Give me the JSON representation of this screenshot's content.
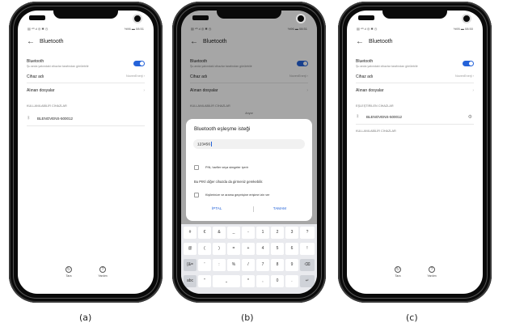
{
  "screens": {
    "a": {
      "status_left": "▤ ⁴ᴳ.ıl ◎ ✱ ◷",
      "status_right": "%96 ▬ 08:51",
      "title": "Bluetooth",
      "bluetooth_label": "Bluetooth",
      "bluetooth_sub": "Şu anda yakındaki cihazlar tarafından görülebilir",
      "device_name_label": "Cihaz adı",
      "device_name_value": "NovenEnerji ›",
      "received_files": "Alınan dosyalar",
      "section_available": "KULLANILABİLİR CİHAZLAR",
      "device_1": "BLENOVENS-500012",
      "action_scan": "Tara",
      "action_help": "Yardım"
    },
    "b": {
      "status_left": "▤ ⁴ᴳ.ıl ◎ ✱ ◷",
      "status_right": "%96 ▬ 08:51",
      "title": "Bluetooth",
      "bluetooth_label": "Bluetooth",
      "bluetooth_sub": "Şu anda yakındaki cihazlar tarafından görülebilir",
      "device_name_label": "Cihaz adı",
      "device_name_value": "NovenEnerji ›",
      "received_files": "Alınan dosyalar",
      "section_available": "KULLANILABİLİR CİHAZLAR",
      "searching": "Arıyor",
      "dialog": {
        "title": "Bluetooth eşleşme isteği",
        "input_value": "123456",
        "checkbox_1": "PIN, harfler veya simgeler içerir",
        "note": "Bu PIN'i diğer cihazda da girmeniz gerekebilir.",
        "checkbox_2": "Kişilerinize ve arama geçmişine erişime izin ver",
        "cancel": "İPTAL",
        "ok": "TAMAM"
      },
      "keyboard": {
        "row1": [
          "#",
          "€",
          "&",
          "_",
          "-",
          "1",
          "2",
          "3",
          "?"
        ],
        "row2": [
          "@",
          "(",
          ")",
          "=",
          "+",
          "4",
          "5",
          "6",
          "!"
        ],
        "row3": [
          "{&=",
          "'",
          ":",
          "%",
          "/",
          "7",
          "8",
          "9",
          "⌫"
        ],
        "row4": [
          "abc",
          "\"",
          "⎵",
          "*",
          ",",
          "0",
          ".",
          "↵"
        ]
      }
    },
    "c": {
      "status_left": "▤ ⁴ᴳ.ıl ◎ ✱ ◷",
      "status_right": "%95 ▬ 08:50",
      "title": "Bluetooth",
      "bluetooth_label": "Bluetooth",
      "bluetooth_sub": "Şu anda yakındaki cihazlar tarafından görülebilir",
      "device_name_label": "Cihaz adı",
      "device_name_value": "NovenEnerji ›",
      "received_files": "Alınan dosyalar",
      "section_paired": "EŞLEŞTİRİLEN CİHAZLAR",
      "device_1": "BLENOVENS-500012",
      "section_available": "KULLANILABİLİR CİHAZLAR",
      "action_scan": "Tara",
      "action_help": "Yardım"
    }
  },
  "captions": [
    "(a)",
    "(b)",
    "(c)"
  ],
  "colors": {
    "accent": "#2563d9",
    "toggle_on": "#2563d9"
  },
  "icons": {
    "back": "arrow-left-icon",
    "bluetooth": "bluetooth-icon",
    "settings": "gear-icon",
    "scan": "refresh-icon",
    "help": "help-icon"
  }
}
